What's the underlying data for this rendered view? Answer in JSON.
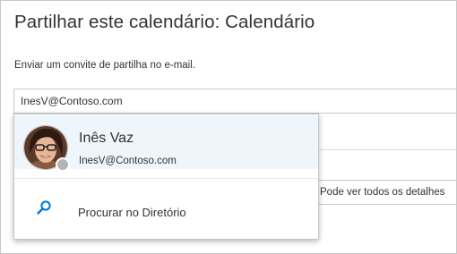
{
  "dialog": {
    "title": "Partilhar este calendário: Calendário",
    "invite_label": "Enviar um convite de partilha no e-mail.",
    "recipient_input_value": "InesV@Contoso.com",
    "permission_value": "Pode ver todos os detalhes"
  },
  "suggestions": [
    {
      "name": "Inês Vaz",
      "email": "InesV@Contoso.com",
      "presence_status": "offline",
      "avatar_icon": "person-photo-icon"
    }
  ],
  "directory_search": {
    "label": "Procurar no Diretório",
    "icon": "search-icon"
  },
  "colors": {
    "accent": "#0078d4",
    "suggestion_highlight": "#eef5fb",
    "border": "#c8c8c8",
    "text": "#333333",
    "presence_offline": "#b4b4b4"
  }
}
